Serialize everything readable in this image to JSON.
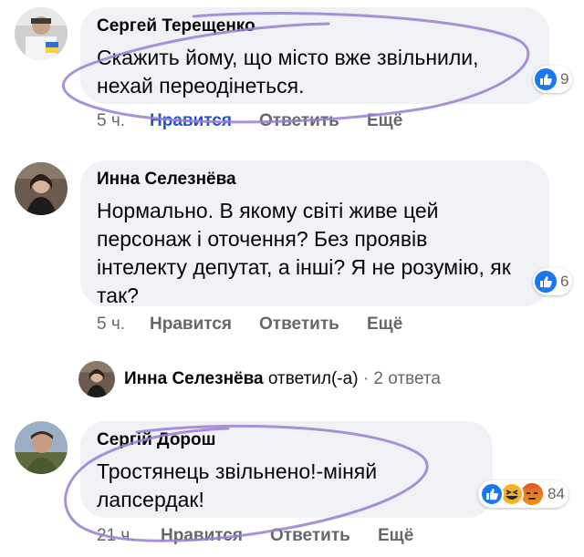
{
  "comments": [
    {
      "author": "Сергей Терещенко",
      "lines": [
        "Скажить йому, що місто вже звільнили,",
        "нехай переодінеться."
      ],
      "reaction_count": "9",
      "time": "5 ч.",
      "like_label": "Нравится",
      "reply_label": "Ответить",
      "more_label": "Ещё"
    },
    {
      "author": "Инна Селезнёва",
      "lines": [
        "Нормально. В якому світі живе цей",
        "персонаж і оточення? Без проявів",
        "інтелекту депутат, а інші? Я не розумію, як",
        "так?"
      ],
      "reaction_count": "6",
      "time": "5 ч.",
      "like_label": "Нравится",
      "reply_label": "Ответить",
      "more_label": "Ещё"
    },
    {
      "author": "Сергій Дорош",
      "lines": [
        "Тростянець звільнено!-міняй",
        "лапсердак!"
      ],
      "reaction_count": "84",
      "time": "21 ч.",
      "like_label": "Нравится",
      "reply_label": "Ответить",
      "more_label": "Ещё"
    }
  ],
  "replies_row": {
    "name": "Инна Селезнёва",
    "verb": "ответил(-а)",
    "count": "· 2 ответа"
  },
  "colors": {
    "bubble": "#f0f2f5",
    "like_blue": "#1877f2",
    "action_grey": "#65676b",
    "annotation_purple": "#9b7fd4"
  }
}
